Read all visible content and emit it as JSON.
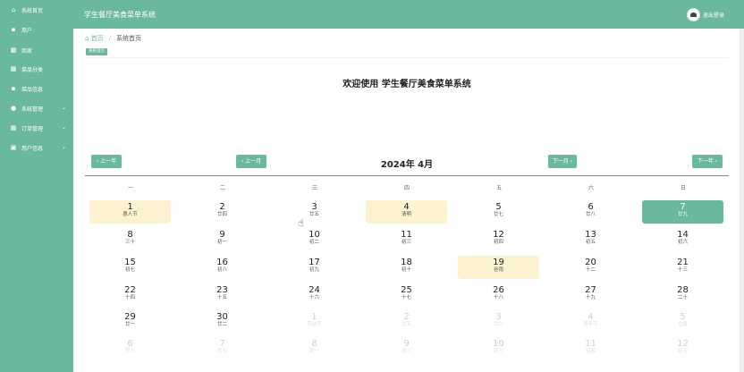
{
  "sidebar": {
    "items": [
      {
        "label": "系统首页",
        "icon": "home-icon",
        "glyph": "⌂",
        "arrow": false
      },
      {
        "label": "用户",
        "icon": "user-icon",
        "glyph": "▪",
        "arrow": false
      },
      {
        "label": "商家",
        "icon": "grid-icon",
        "glyph": "▦",
        "arrow": false
      },
      {
        "label": "菜品分类",
        "icon": "grid-icon",
        "glyph": "▦",
        "arrow": false
      },
      {
        "label": "菜品信息",
        "icon": "bag-icon",
        "glyph": "▪",
        "arrow": false
      },
      {
        "label": "系统管理",
        "icon": "pin-icon",
        "glyph": "●",
        "arrow": true
      },
      {
        "label": "订单管理",
        "icon": "grid-icon",
        "glyph": "▦",
        "arrow": true
      },
      {
        "label": "用户信息",
        "icon": "profile-icon",
        "glyph": "▣",
        "arrow": true
      }
    ]
  },
  "header": {
    "title": "学生餐厅美食菜单系统",
    "logout": "退出登录"
  },
  "breadcrumb": {
    "home": "首页",
    "sep": "/",
    "current": "系统首页"
  },
  "tag": "系统首页",
  "welcome": "欢迎使用 学生餐厅美食菜单系统",
  "calendar": {
    "title": "2024年 4月",
    "prev_year": "‹ 上一年",
    "prev_month": "‹ 上一月",
    "next_month": "下一月 ›",
    "next_year": "下一年 ›",
    "weekdays": [
      "一",
      "二",
      "三",
      "四",
      "五",
      "六",
      "日"
    ],
    "weeks": [
      [
        {
          "d": "1",
          "l": "愚人节",
          "s": "hl"
        },
        {
          "d": "2",
          "l": "廿四"
        },
        {
          "d": "3",
          "l": "廿五"
        },
        {
          "d": "4",
          "l": "清明",
          "s": "hl"
        },
        {
          "d": "5",
          "l": "廿七"
        },
        {
          "d": "6",
          "l": "廿八"
        },
        {
          "d": "7",
          "l": "廿九",
          "s": "sel"
        }
      ],
      [
        {
          "d": "8",
          "l": "三十"
        },
        {
          "d": "9",
          "l": "初一"
        },
        {
          "d": "10",
          "l": "初二"
        },
        {
          "d": "11",
          "l": "初三"
        },
        {
          "d": "12",
          "l": "初四"
        },
        {
          "d": "13",
          "l": "初五"
        },
        {
          "d": "14",
          "l": "初六"
        }
      ],
      [
        {
          "d": "15",
          "l": "初七"
        },
        {
          "d": "16",
          "l": "初八"
        },
        {
          "d": "17",
          "l": "初九"
        },
        {
          "d": "18",
          "l": "初十"
        },
        {
          "d": "19",
          "l": "谷雨",
          "s": "hl"
        },
        {
          "d": "20",
          "l": "十二"
        },
        {
          "d": "21",
          "l": "十三"
        }
      ],
      [
        {
          "d": "22",
          "l": "十四"
        },
        {
          "d": "23",
          "l": "十五"
        },
        {
          "d": "24",
          "l": "十六"
        },
        {
          "d": "25",
          "l": "十七"
        },
        {
          "d": "26",
          "l": "十八"
        },
        {
          "d": "27",
          "l": "十九"
        },
        {
          "d": "28",
          "l": "二十"
        }
      ],
      [
        {
          "d": "29",
          "l": "廿一"
        },
        {
          "d": "30",
          "l": "廿二"
        },
        {
          "d": "1",
          "l": "劳动节",
          "s": "other"
        },
        {
          "d": "2",
          "l": "廿五",
          "s": "other"
        },
        {
          "d": "3",
          "l": "廿六",
          "s": "other"
        },
        {
          "d": "4",
          "l": "青年节",
          "s": "other"
        },
        {
          "d": "5",
          "l": "立夏",
          "s": "other"
        }
      ],
      [
        {
          "d": "6",
          "l": "廿八",
          "s": "other"
        },
        {
          "d": "7",
          "l": "廿九",
          "s": "other"
        },
        {
          "d": "8",
          "l": "初一",
          "s": "other"
        },
        {
          "d": "9",
          "l": "初二",
          "s": "other"
        },
        {
          "d": "10",
          "l": "初三",
          "s": "other"
        },
        {
          "d": "11",
          "l": "初四",
          "s": "other"
        },
        {
          "d": "12",
          "l": "初五",
          "s": "other"
        }
      ]
    ]
  },
  "colors": {
    "accent": "#6bb99d",
    "highlight": "#fdf2cf"
  }
}
